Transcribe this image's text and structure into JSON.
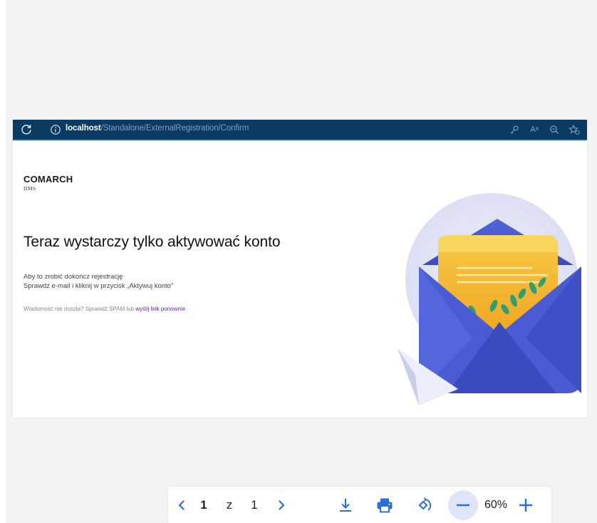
{
  "browser": {
    "url_host": "localhost",
    "url_path": "/Standalone/ExternalRegistration/Confirm",
    "icons": [
      "reload-icon",
      "info-icon",
      "key-icon",
      "read-aloud-icon",
      "zoom-icon",
      "favorite-icon"
    ],
    "read_aloud_glyph": "Aᵃ"
  },
  "page": {
    "logo_main": "COMARCH",
    "logo_sub": "DMS",
    "headline": "Teraz wystarczy tylko aktywować konto",
    "desc_line1": "Aby to zrobić dokończ rejestrację",
    "desc_line2": "Sprawdź e-mail i kliknij w przycisk „Aktywuj konto”",
    "note_text": "Wiadomość nie doszła? Sprawdź SPAM lub ",
    "note_link": "wyślij link ponownie"
  },
  "toolbar": {
    "current_page": "1",
    "page_separator": "z",
    "total_pages": "1",
    "zoom_level": "60%",
    "icons": [
      "prev-page-icon",
      "next-page-icon",
      "download-icon",
      "print-icon",
      "rotate-icon",
      "zoom-out-icon",
      "zoom-in-icon"
    ]
  },
  "colors": {
    "browser_bar": "#0b3a63",
    "accent": "#2b6fd6",
    "link": "#5c2d91",
    "envelope": "#4a5bd4",
    "letter": "#f4b832"
  }
}
